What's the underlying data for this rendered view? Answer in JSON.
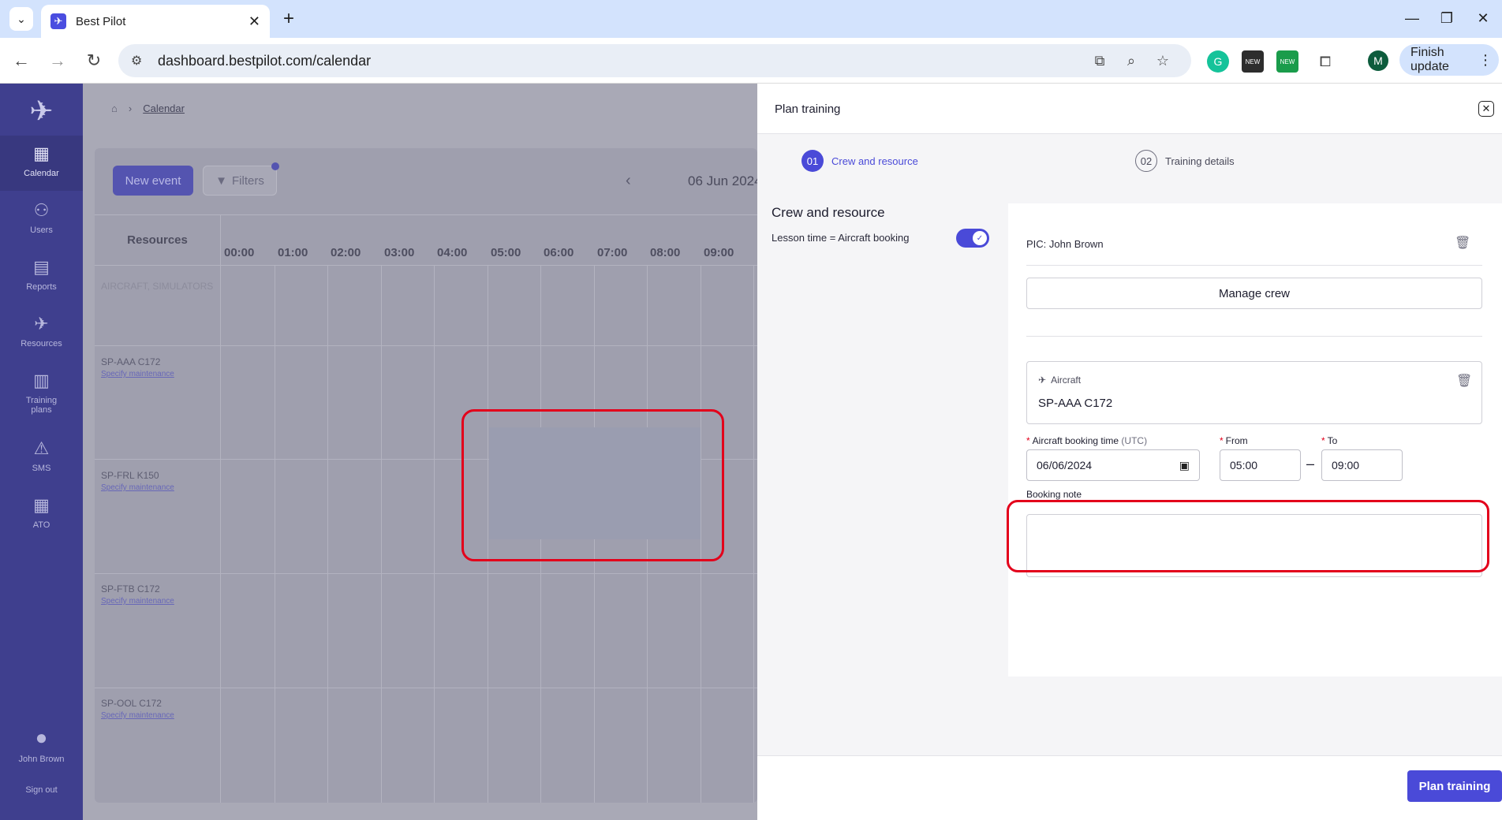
{
  "browser": {
    "tab_title": "Best Pilot",
    "url": "dashboard.bestpilot.com/calendar",
    "profile_initial": "M",
    "finish_update_label": "Finish update",
    "new_badge": "NEW"
  },
  "sidebar": {
    "items": [
      {
        "label": "Calendar",
        "icon": "calendar-icon"
      },
      {
        "label": "Users",
        "icon": "users-icon"
      },
      {
        "label": "Reports",
        "icon": "reports-icon"
      },
      {
        "label": "Resources",
        "icon": "plane-icon"
      },
      {
        "label": "Training plans",
        "icon": "book-icon"
      },
      {
        "label": "SMS",
        "icon": "warning-icon"
      },
      {
        "label": "ATO",
        "icon": "building-icon"
      }
    ],
    "user_name": "John Brown",
    "sign_out": "Sign out"
  },
  "calendar": {
    "breadcrumb_current": "Calendar",
    "new_event_label": "New event",
    "filters_label": "Filters",
    "date_label": "06 Jun 2024",
    "resources_header": "Resources",
    "hours": [
      "00:00",
      "01:00",
      "02:00",
      "03:00",
      "04:00",
      "05:00",
      "06:00",
      "07:00",
      "08:00",
      "09:00"
    ],
    "group_label": "AIRCRAFT, SIMULATORS",
    "resources": [
      {
        "name": "SP-AAA C172",
        "link": "Specify maintenance"
      },
      {
        "name": "SP-FRL K150",
        "link": "Specify maintenance"
      },
      {
        "name": "SP-FTB C172",
        "link": "Specify maintenance"
      },
      {
        "name": "SP-OOL C172",
        "link": "Specify maintenance"
      }
    ]
  },
  "drawer": {
    "title": "Plan training",
    "steps": [
      {
        "num": "01",
        "label": "Crew and resource"
      },
      {
        "num": "02",
        "label": "Training details"
      }
    ],
    "section_title": "Crew and resource",
    "lesson_time_label": "Lesson time = Aircraft booking",
    "pic_label": "PIC: John Brown",
    "manage_crew_label": "Manage crew",
    "aircraft_label": "Aircraft",
    "aircraft_name": "SP-AAA C172",
    "booking_time_label": "Aircraft booking time",
    "booking_time_unit": "(UTC)",
    "date_value": "06/06/2024",
    "from_label": "From",
    "from_value": "05:00",
    "to_label": "To",
    "to_value": "09:00",
    "booking_note_label": "Booking note",
    "plan_button_label": "Plan training"
  }
}
